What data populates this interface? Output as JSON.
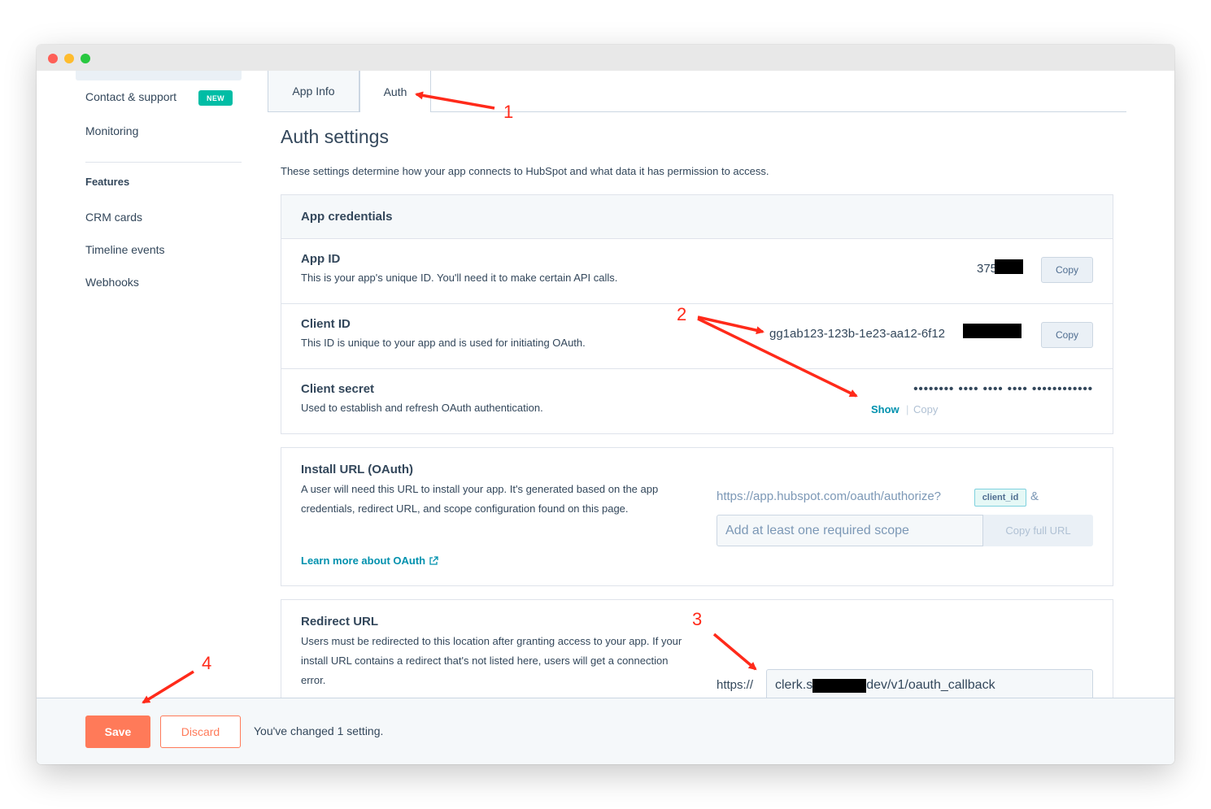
{
  "sidebar": {
    "items": [
      {
        "label": "Contact & support",
        "badge": "NEW"
      },
      {
        "label": "Monitoring"
      }
    ],
    "section_heading": "Features",
    "feature_items": [
      "CRM cards",
      "Timeline events",
      "Webhooks"
    ]
  },
  "tabs": [
    {
      "label": "App Info",
      "active": false
    },
    {
      "label": "Auth",
      "active": true
    }
  ],
  "page": {
    "title": "Auth settings",
    "description": "These settings determine how your app connects to HubSpot and what data it has permission to access."
  },
  "credentials": {
    "title": "App credentials",
    "app_id": {
      "label": "App ID",
      "desc": "This is your app's unique ID. You'll need it to make certain API calls.",
      "value": "375",
      "copy_label": "Copy"
    },
    "client_id": {
      "label": "Client ID",
      "desc": "This ID is unique to your app and is used for initiating OAuth.",
      "value": "gg1ab123-123b-1e23-aa12-6f12",
      "copy_label": "Copy"
    },
    "client_secret": {
      "label": "Client secret",
      "desc": "Used to establish and refresh OAuth authentication.",
      "value": "•••••••• •••• •••• •••• ••••••••••••",
      "show_label": "Show",
      "separator": "|",
      "copy_label": "Copy"
    }
  },
  "install": {
    "title": "Install URL (OAuth)",
    "desc": "A user will need this URL to install your app. It's generated based on the app credentials, redirect URL, and scope configuration found on this page.",
    "url_prefix": "https://app.hubspot.com/oauth/authorize?",
    "chip": "client_id",
    "amp": "&",
    "scope_placeholder": "Add at least one required scope",
    "copy_full_label": "Copy full URL",
    "learn_more": "Learn more about OAuth"
  },
  "redirect": {
    "title": "Redirect URL",
    "desc": "Users must be redirected to this location after granting access to your app. If your install URL contains a redirect that's not listed here, users will get a connection error.",
    "scheme": "https://",
    "value_start": "clerk.s",
    "value_end": "dev/v1/oauth_callback"
  },
  "footer": {
    "save_label": "Save",
    "discard_label": "Discard",
    "message": "You've changed 1 setting."
  },
  "annotations": {
    "labels": [
      "1",
      "2",
      "3",
      "4"
    ],
    "color": "#ff2a1a"
  },
  "colors": {
    "accent_orange": "#ff7a59",
    "link_teal": "#0091ae",
    "badge_teal": "#00bda5",
    "text": "#33475b"
  }
}
